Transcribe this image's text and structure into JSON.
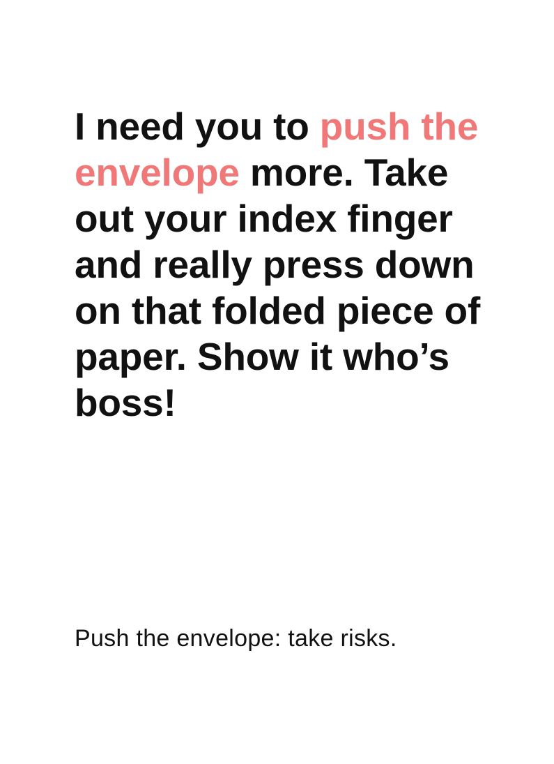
{
  "card": {
    "quote": {
      "before": "I need you to ",
      "highlight": "push the envelope",
      "after": " more. Take out your index finger and really press down on that folded piece of paper. Show it who’s boss!"
    },
    "definition": "Push the envelope: take risks."
  },
  "colors": {
    "highlight": "#f07878",
    "text": "#111111",
    "background": "#ffffff"
  }
}
